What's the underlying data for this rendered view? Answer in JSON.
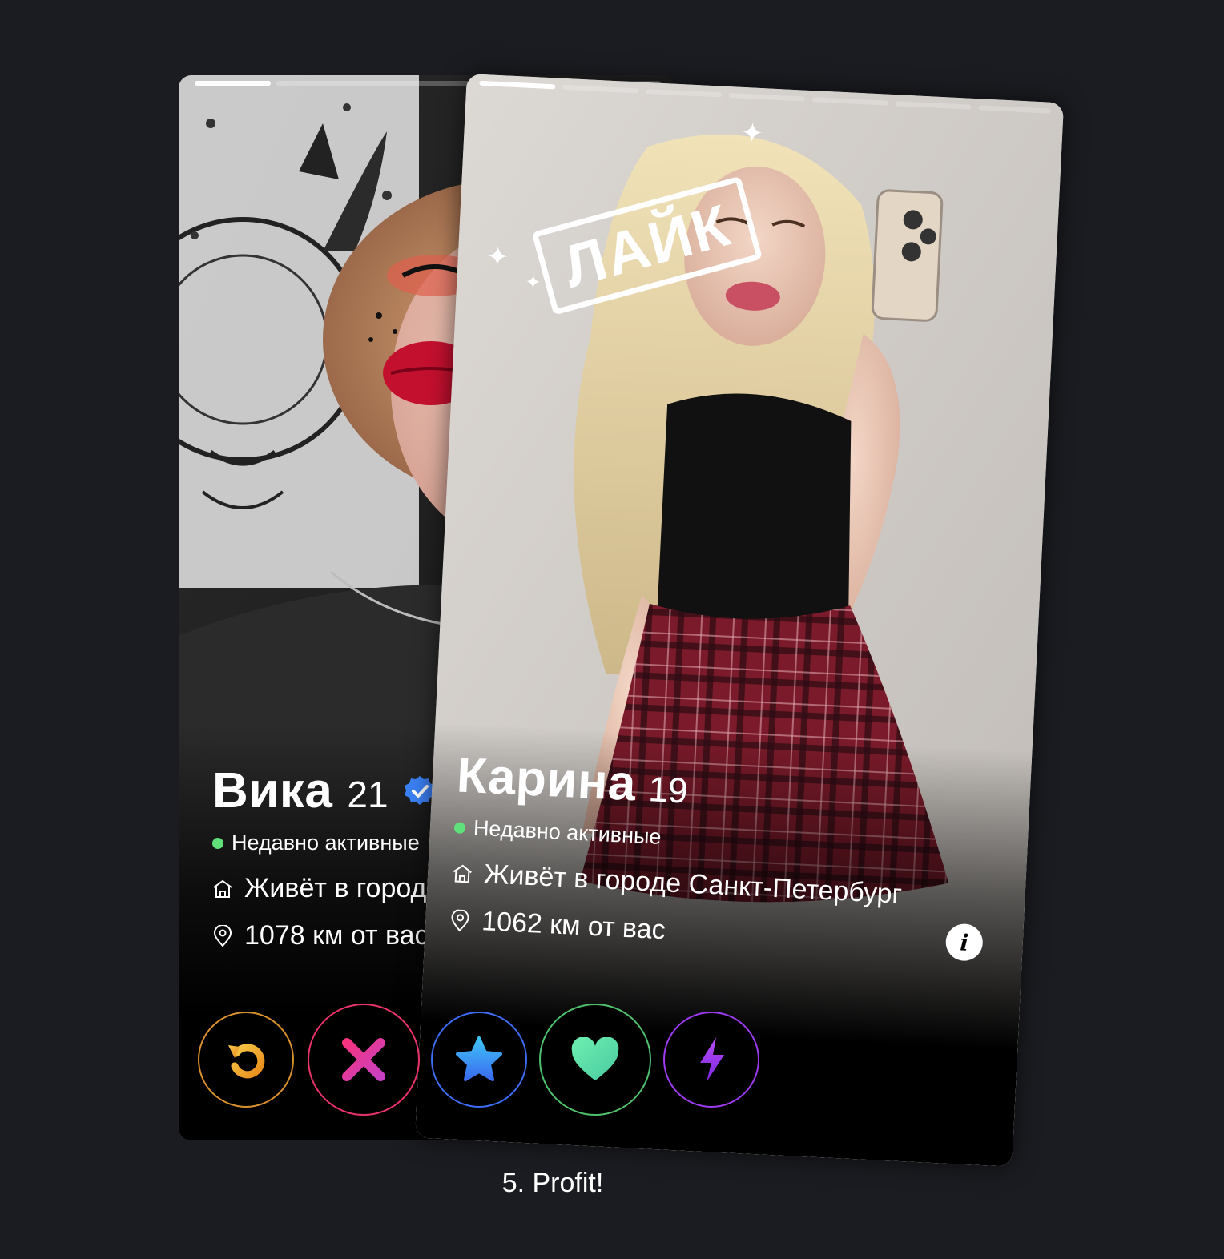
{
  "background_color": "#1b1c21",
  "back_card": {
    "name": "Вика",
    "age": "21",
    "verified": true,
    "status": "Недавно активные",
    "city": "Живёт в городе",
    "distance": "1078 км от вас"
  },
  "front_card": {
    "stamp": "ЛАЙК",
    "name": "Карина",
    "age": "19",
    "status": "Недавно активные",
    "city": "Живёт в городе Санкт-Петербург",
    "distance": "1062 км от вас",
    "info_icon": "i",
    "photo_count": 7,
    "current_photo": 1
  },
  "actions": [
    {
      "name": "rewind",
      "icon": "rewind-icon",
      "color": "#f2a733"
    },
    {
      "name": "nope",
      "icon": "close-icon",
      "color": "#e8336b"
    },
    {
      "name": "super-like",
      "icon": "star-icon",
      "color": "#3d9bf2"
    },
    {
      "name": "like",
      "icon": "heart-icon",
      "color": "#5ae39a"
    },
    {
      "name": "boost",
      "icon": "lightning-icon",
      "color": "#9d3bf0"
    }
  ],
  "colors": {
    "online": "#5fe07a",
    "verified": "#3b82f6"
  },
  "caption": "5. Profit!"
}
